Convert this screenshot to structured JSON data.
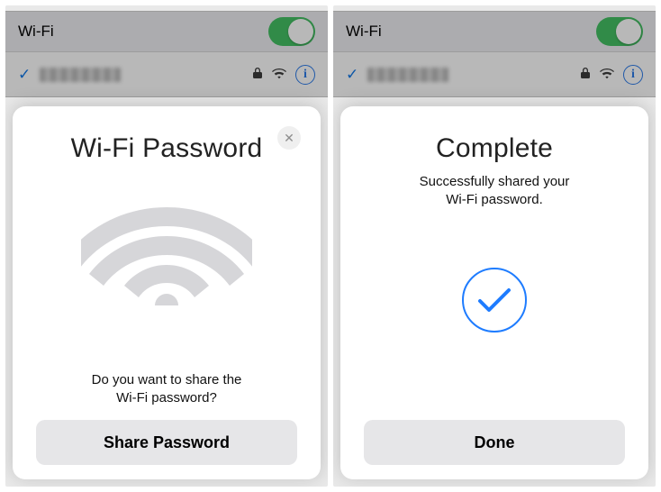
{
  "left": {
    "wifi_label": "Wi-Fi",
    "sheet_title": "Wi-Fi Password",
    "sheet_message": "Do you want to share the\nWi-Fi password?",
    "button_label": "Share Password"
  },
  "right": {
    "wifi_label": "Wi-Fi",
    "sheet_title": "Complete",
    "sheet_message": "Successfully shared your\nWi-Fi password.",
    "button_label": "Done"
  },
  "icons": {
    "info_letter": "i"
  }
}
